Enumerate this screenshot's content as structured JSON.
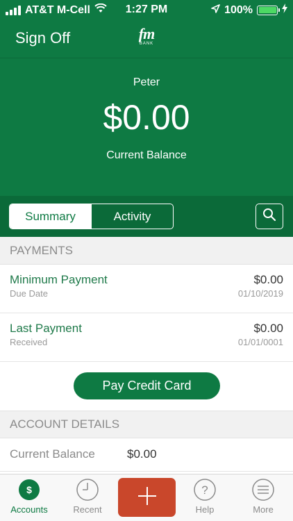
{
  "status_bar": {
    "carrier": "AT&T M-Cell",
    "time": "1:27 PM",
    "battery": "100%"
  },
  "nav": {
    "sign_off": "Sign Off",
    "logo_text": "fm",
    "logo_subtext": "BANK"
  },
  "account": {
    "holder": "Peter",
    "balance": "$0.00",
    "balance_caption": "Current Balance"
  },
  "tabs": {
    "summary": "Summary",
    "activity": "Activity"
  },
  "payments": {
    "header": "PAYMENTS",
    "items": [
      {
        "title": "Minimum Payment",
        "subtitle": "Due Date",
        "amount": "$0.00",
        "date": "01/10/2019"
      },
      {
        "title": "Last Payment",
        "subtitle": "Received",
        "amount": "$0.00",
        "date": "01/01/0001"
      }
    ],
    "pay_button": "Pay Credit Card"
  },
  "account_details": {
    "header": "ACCOUNT DETAILS",
    "rows": [
      {
        "label": "Current Balance",
        "value": "$0.00"
      }
    ]
  },
  "tab_bar": {
    "accounts": "Accounts",
    "accounts_icon_glyph": "$",
    "recent": "Recent",
    "help": "Help",
    "help_icon_glyph": "?",
    "more": "More"
  },
  "colors": {
    "brand_green": "#0e7a43",
    "accent_red": "#c9472b"
  }
}
